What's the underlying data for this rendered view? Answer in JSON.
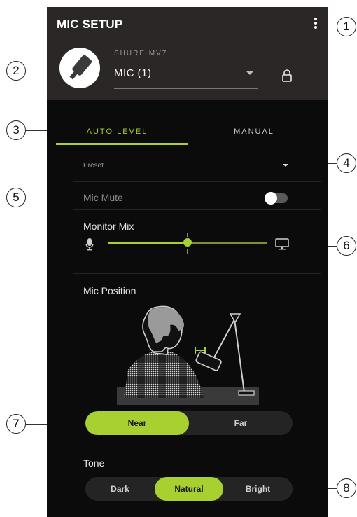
{
  "header": {
    "title": "MIC SETUP"
  },
  "device": {
    "model": "SHURE MV7",
    "name": "MIC (1)"
  },
  "tabs": [
    {
      "label": "AUTO LEVEL",
      "active": true
    },
    {
      "label": "MANUAL",
      "active": false
    }
  ],
  "preset": {
    "label": "Preset"
  },
  "mic_mute": {
    "label": "Mic Mute",
    "on": false
  },
  "monitor_mix": {
    "label": "Monitor Mix",
    "value": 0.5,
    "left_icon": "microphone-icon",
    "right_icon": "monitor-icon"
  },
  "mic_position": {
    "label": "Mic Position",
    "options": [
      "Near",
      "Far"
    ],
    "selected": "Near"
  },
  "tone": {
    "label": "Tone",
    "options": [
      "Dark",
      "Natural",
      "Bright"
    ],
    "selected": "Natural"
  },
  "callouts": [
    "1",
    "2",
    "3",
    "4",
    "5",
    "6",
    "7",
    "8"
  ],
  "colors": {
    "accent": "#a8d030",
    "header_bg": "#2a2726",
    "body_bg": "#0b0b0b"
  }
}
